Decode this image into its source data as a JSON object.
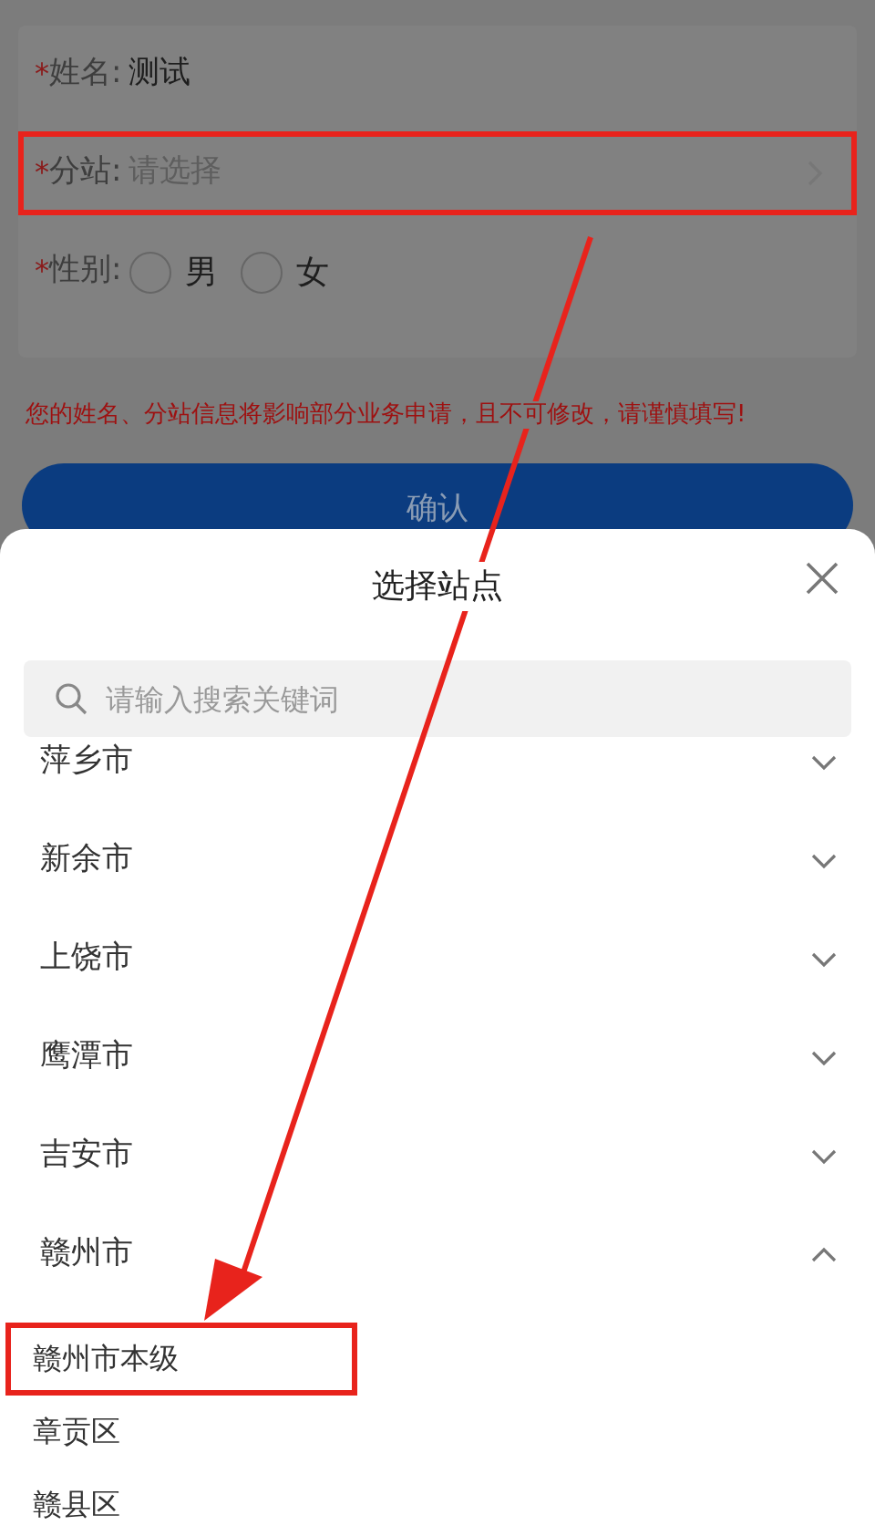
{
  "form": {
    "fields": [
      {
        "kind": "text",
        "marker": "*",
        "label": "姓名:",
        "value": "测试",
        "highlighted": false
      },
      {
        "kind": "select",
        "marker": "*",
        "label": "分站:",
        "placeholder": "请选择",
        "highlighted": true
      },
      {
        "kind": "radio",
        "marker": "*",
        "label": "性别:",
        "highlighted": false,
        "options": [
          {
            "label": "男",
            "selected": false
          },
          {
            "label": "女",
            "selected": false
          }
        ]
      }
    ]
  },
  "notice": "您的姓名、分站信息将影响部分业务申请，且不可修改，请谨慎填写!",
  "confirm_button": "确认",
  "sheet": {
    "title": "选择站点",
    "search": {
      "placeholder": "请输入搜索关键词"
    },
    "cities": [
      {
        "name": "萍乡市",
        "expanded": false
      },
      {
        "name": "新余市",
        "expanded": false
      },
      {
        "name": "上饶市",
        "expanded": false
      },
      {
        "name": "鹰潭市",
        "expanded": false
      },
      {
        "name": "吉安市",
        "expanded": false
      },
      {
        "name": "赣州市",
        "expanded": true,
        "children": [
          {
            "name": "赣州市本级",
            "highlighted": true
          },
          {
            "name": "章贡区",
            "highlighted": false
          },
          {
            "name": "赣县区",
            "highlighted": false
          }
        ]
      }
    ]
  }
}
